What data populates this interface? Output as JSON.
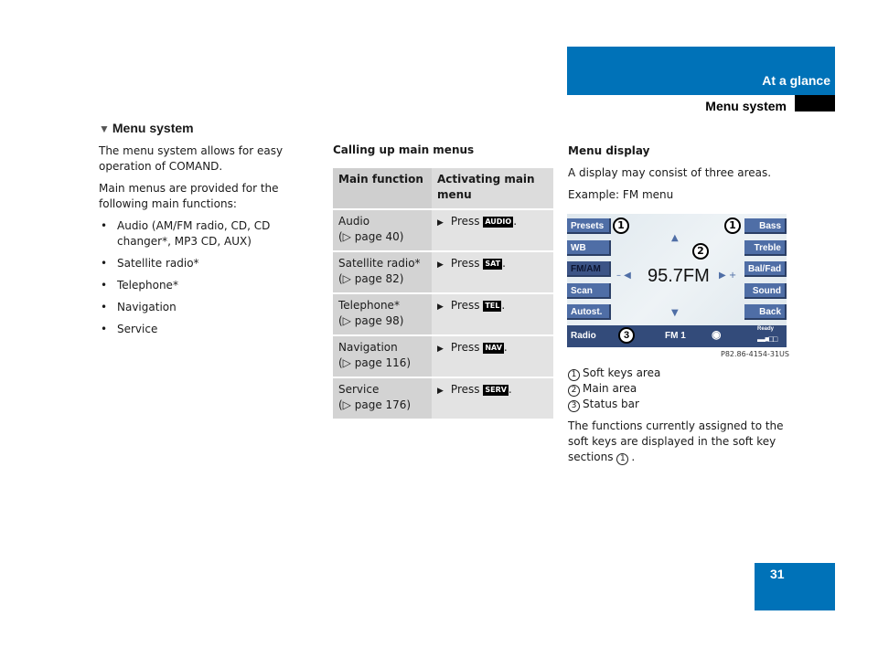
{
  "header": {
    "chapter": "At a glance",
    "section": "Menu system"
  },
  "page_number": "31",
  "section_title": "Menu system",
  "col1": {
    "intro": "The menu system allows for easy operation of COMAND.",
    "lead": "Main menus are provided for the following main functions:",
    "bullets": [
      "Audio (AM/FM radio, CD, CD changer*, MP3 CD, AUX)",
      "Satellite radio*",
      "Telephone*",
      "Navigation",
      "Service"
    ]
  },
  "col2": {
    "title": "Calling up main menus",
    "table": {
      "headers": [
        "Main function",
        "Activating main menu"
      ],
      "rows": [
        {
          "function": "Audio",
          "page": "(▷ page 40)",
          "press": "Press",
          "key": "AUDIO"
        },
        {
          "function": "Satellite radio*",
          "page": "(▷ page 82)",
          "press": "Press",
          "key": "SAT"
        },
        {
          "function": "Telephone*",
          "page": "(▷ page 98)",
          "press": "Press",
          "key": "TEL"
        },
        {
          "function": "Navigation",
          "page": "(▷ page 116)",
          "press": "Press",
          "key": "NAV"
        },
        {
          "function": "Service",
          "page": "(▷ page 176)",
          "press": "Press",
          "key": "SERV"
        }
      ]
    }
  },
  "col3": {
    "title": "Menu display",
    "p1": "A display may consist of three areas.",
    "p2": "Example: FM menu",
    "legend": [
      {
        "num": "1",
        "label": "Soft keys area"
      },
      {
        "num": "2",
        "label": "Main area"
      },
      {
        "num": "3",
        "label": "Status bar"
      }
    ],
    "closing": "The functions currently assigned to the soft keys are displayed in the soft key sections",
    "closing_ref": "1"
  },
  "radio": {
    "left_keys": [
      "Presets",
      "WB",
      "FM/AM",
      "Scan",
      "Autost."
    ],
    "right_keys": [
      "Bass",
      "Treble",
      "Bal/Fad",
      "Sound",
      "Back"
    ],
    "frequency": "95.7FM",
    "status_left": "Radio",
    "status_mid": "FM 1",
    "status_ready": "Ready",
    "callouts": [
      "1",
      "1",
      "2",
      "3"
    ],
    "image_ref": "P82.86-4154-31US"
  }
}
